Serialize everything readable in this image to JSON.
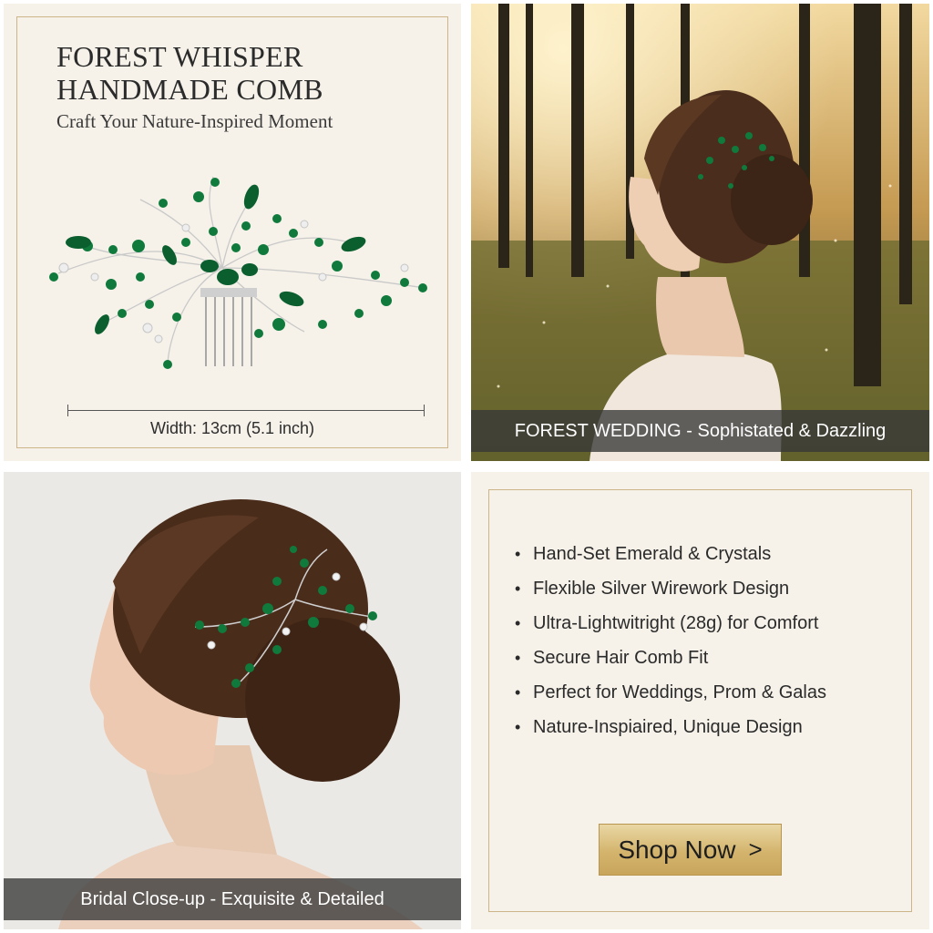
{
  "product_panel": {
    "title_line_1": "FOREST WHISPER",
    "title_line_2": "HANDMADE COMB",
    "subtitle": "Craft Your Nature-Inspired Moment",
    "width_label": "Width: 13cm (5.1 inch)"
  },
  "forest_panel": {
    "caption": "FOREST WEDDING - Sophistated & Dazzling"
  },
  "closeup_panel": {
    "caption": "Bridal Close-up - Exquisite & Detailed"
  },
  "features_panel": {
    "items": [
      {
        "bullet": "•",
        "text": "Hand-Set Emerald & Crystals"
      },
      {
        "bullet": "•",
        "text": "Flexible Silver Wirework Design"
      },
      {
        "bullet": "•",
        "text": "Ultra-Lightwitright (28g) for Comfort"
      },
      {
        "bullet": "•",
        "text": "Secure Hair Comb Fit"
      },
      {
        "bullet": "•",
        "text": "Perfect for Weddings, Prom & Galas"
      },
      {
        "bullet": "•",
        "text": "Nature-Inspiaired, Unique Design"
      }
    ],
    "shop_button_label": "Shop Now",
    "shop_button_icon": "chevron-right-icon"
  },
  "colors": {
    "emerald": "#0f7a3c",
    "gold_frame": "#cdb58a",
    "cream": "#f6f2e9"
  }
}
